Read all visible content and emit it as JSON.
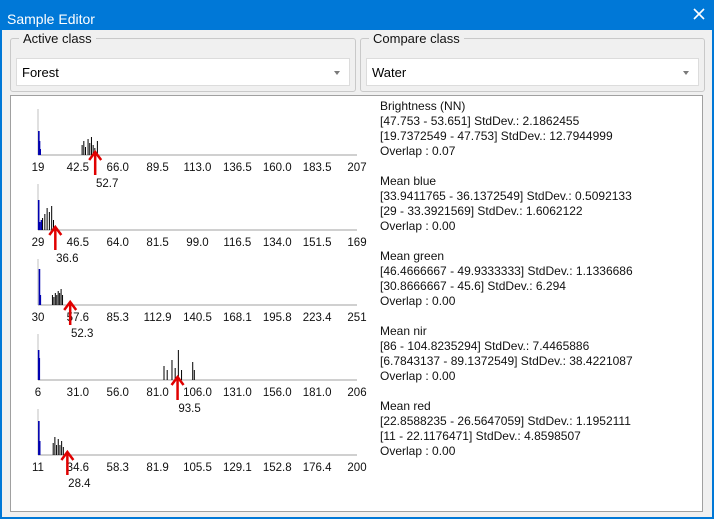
{
  "window": {
    "title": "Sample Editor"
  },
  "active_class": {
    "label": "Active class",
    "value": "Forest"
  },
  "compare_class": {
    "label": "Compare class",
    "value": "Water"
  },
  "features": [
    {
      "name": "Brightness (NN)",
      "active_range": "[47.753 - 53.651] StdDev.: 2.1862455",
      "compare_range": "[19.7372549 - 47.753] StdDev.: 12.7944999",
      "overlap": "Overlap : 0.07",
      "ticks": [
        "19",
        "42.5",
        "66.0",
        "89.5",
        "113.0",
        "136.5",
        "160.0",
        "183.5",
        "207"
      ],
      "min": 19,
      "max": 207,
      "marker": "52.7",
      "marker_value": 52.7,
      "water_bars": [
        [
          19.5,
          24
        ],
        [
          19.9,
          14
        ],
        [
          20.3,
          6
        ]
      ],
      "forest_bars": [
        [
          45,
          10
        ],
        [
          46,
          14
        ],
        [
          47,
          8
        ],
        [
          48.5,
          16
        ],
        [
          49.5,
          12
        ],
        [
          50.5,
          18
        ],
        [
          51.5,
          10
        ],
        [
          52.5,
          7
        ],
        [
          54,
          14
        ]
      ]
    },
    {
      "name": "Mean blue",
      "active_range": "[33.9411765 - 36.1372549] StdDev.: 0.5092133",
      "compare_range": "[29 - 33.3921569] StdDev.: 1.6062122",
      "overlap": "Overlap : 0.00",
      "ticks": [
        "29",
        "46.5",
        "64.0",
        "81.5",
        "99.0",
        "116.5",
        "134.0",
        "151.5",
        "169"
      ],
      "min": 29,
      "max": 169,
      "marker": "36.6",
      "marker_value": 36.6,
      "water_bars": [
        [
          29.3,
          30
        ],
        [
          29.8,
          8
        ],
        [
          30.5,
          10
        ]
      ],
      "forest_bars": [
        [
          31,
          12
        ],
        [
          32,
          16
        ],
        [
          33,
          22
        ],
        [
          34,
          18
        ],
        [
          35,
          24
        ],
        [
          35.8,
          10
        ]
      ]
    },
    {
      "name": "Mean green",
      "active_range": "[46.4666667 - 49.9333333] StdDev.: 1.1336686",
      "compare_range": "[30.8666667 - 45.6] StdDev.: 6.294",
      "overlap": "Overlap : 0.00",
      "ticks": [
        "30",
        "57.6",
        "85.3",
        "112.9",
        "140.5",
        "168.1",
        "195.8",
        "223.4",
        "251"
      ],
      "min": 30,
      "max": 251,
      "marker": "52.3",
      "marker_value": 52.3,
      "water_bars": [
        [
          31,
          36
        ],
        [
          31.6,
          10
        ]
      ],
      "forest_bars": [
        [
          40,
          10
        ],
        [
          41,
          8
        ],
        [
          42,
          12
        ],
        [
          43,
          10
        ],
        [
          44,
          14
        ],
        [
          45,
          12
        ],
        [
          46,
          16
        ],
        [
          47,
          10
        ]
      ]
    },
    {
      "name": "Mean nir",
      "active_range": "[86 - 104.8235294] StdDev.: 7.4465886",
      "compare_range": "[6.7843137 - 89.1372549] StdDev.: 38.4221087",
      "overlap": "Overlap : 0.00",
      "ticks": [
        "6",
        "31.0",
        "56.0",
        "81.0",
        "106.0",
        "131.0",
        "156.0",
        "181.0",
        "206"
      ],
      "min": 6,
      "max": 206,
      "marker": "93.5",
      "marker_value": 93.5,
      "water_bars": [
        [
          6.4,
          30
        ],
        [
          6.8,
          22
        ]
      ],
      "forest_bars": [
        [
          85,
          14
        ],
        [
          87,
          10
        ],
        [
          90,
          20
        ],
        [
          92,
          12
        ],
        [
          94,
          30
        ],
        [
          96,
          10
        ],
        [
          103,
          18
        ],
        [
          104,
          10
        ]
      ]
    },
    {
      "name": "Mean red",
      "active_range": "[22.8588235 - 26.5647059] StdDev.: 1.1952111",
      "compare_range": "[11 - 22.1176471] StdDev.: 4.8598507",
      "overlap": "Overlap : 0.00",
      "ticks": [
        "11",
        "34.6",
        "58.3",
        "81.9",
        "105.5",
        "129.1",
        "152.8",
        "176.4",
        "200"
      ],
      "min": 11,
      "max": 200,
      "marker": "28.4",
      "marker_value": 28.4,
      "water_bars": [
        [
          11.5,
          34
        ],
        [
          12,
          14
        ]
      ],
      "forest_bars": [
        [
          20,
          12
        ],
        [
          21,
          18
        ],
        [
          22,
          10
        ],
        [
          23,
          16
        ],
        [
          24,
          10
        ],
        [
          25,
          14
        ],
        [
          26,
          8
        ]
      ]
    }
  ],
  "colors": {
    "water": "#0000b0",
    "forest": "#000000",
    "marker": "#e00000",
    "titlebar": "#0078d7"
  }
}
